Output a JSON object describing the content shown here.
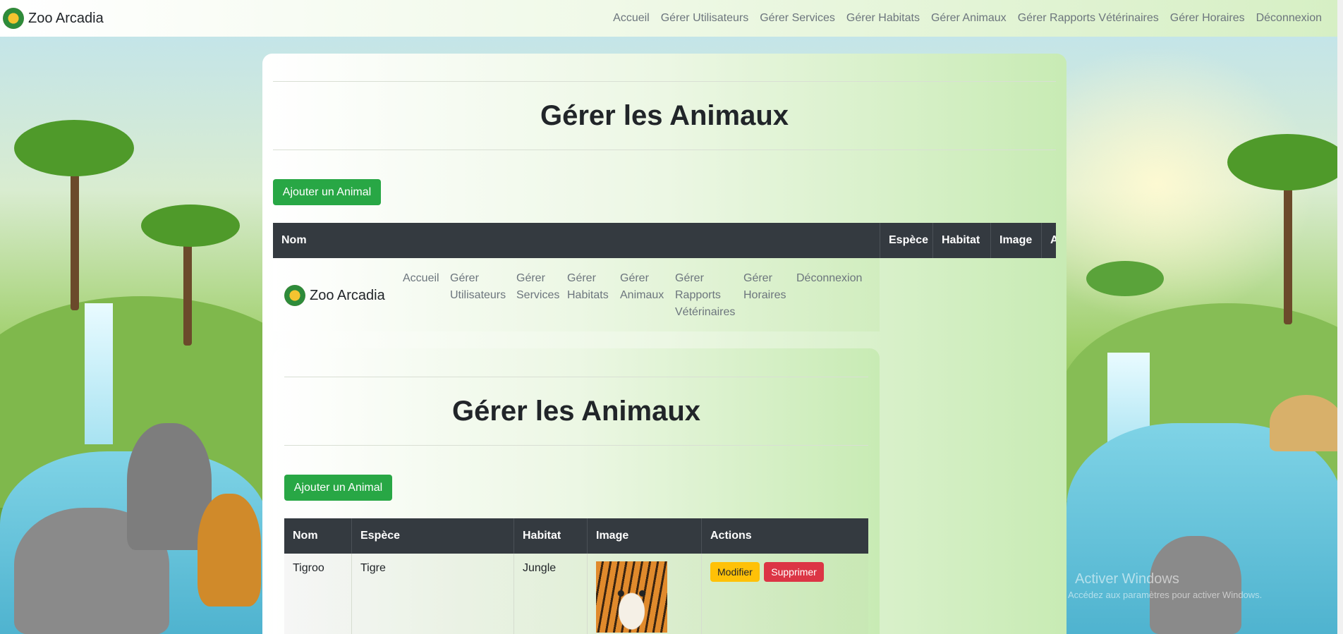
{
  "navbar": {
    "brand": "Zoo Arcadia",
    "links": [
      "Accueil",
      "Gérer Utilisateurs",
      "Gérer Services",
      "Gérer Habitats",
      "Gérer Animaux",
      "Gérer Rapports Vétérinaires",
      "Gérer Horaires",
      "Déconnexion"
    ]
  },
  "page": {
    "title": "Gérer les Animaux",
    "add_button": "Ajouter un Animal",
    "columns": [
      "Nom",
      "Espèce",
      "Habitat",
      "Image",
      "A"
    ]
  },
  "inner_navbar": {
    "brand": "Zoo Arcadia",
    "links": [
      {
        "line1": "Accueil",
        "line2": "",
        "line3": ""
      },
      {
        "line1": "Gérer",
        "line2": "Utilisateurs",
        "line3": ""
      },
      {
        "line1": "Gérer",
        "line2": "Services",
        "line3": ""
      },
      {
        "line1": "Gérer",
        "line2": "Habitats",
        "line3": ""
      },
      {
        "line1": "Gérer",
        "line2": "Animaux",
        "line3": ""
      },
      {
        "line1": "Gérer",
        "line2": "Rapports",
        "line3": "Vétérinaires"
      },
      {
        "line1": "Gérer",
        "line2": "Horaires",
        "line3": ""
      },
      {
        "line1": "Déconnexion",
        "line2": "",
        "line3": ""
      }
    ]
  },
  "inner_page": {
    "title": "Gérer les Animaux",
    "add_button": "Ajouter un Animal",
    "columns": [
      "Nom",
      "Espèce",
      "Habitat",
      "Image",
      "Actions"
    ],
    "rows": [
      {
        "nom": "Tigroo",
        "espece": "Tigre",
        "habitat": "Jungle",
        "image": "tiger-photo",
        "edit": "Modifier",
        "delete": "Supprimer"
      }
    ]
  },
  "watermark": {
    "line1": "Activer Windows",
    "line2": "Accédez aux paramètres pour activer Windows."
  }
}
